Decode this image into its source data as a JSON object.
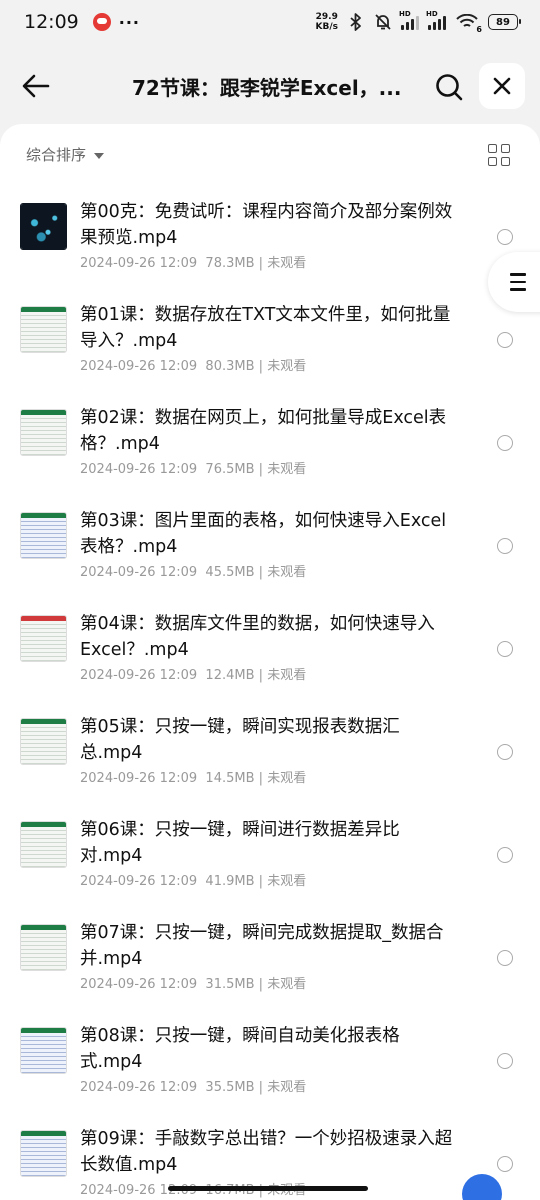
{
  "status_bar": {
    "time": "12:09",
    "net_speed_value": "29.9",
    "net_speed_unit": "KB/s",
    "signal_tag_1": "HD",
    "signal_tag_2": "HD",
    "wifi_tag": "6",
    "battery": "89"
  },
  "header": {
    "title": "72节课：跟李锐学Excel，..."
  },
  "sort": {
    "label": "综合排序"
  },
  "files": [
    {
      "name": "第00克：免费试听：课程内容简介及部分案例效果预览.mp4",
      "date": "2024-09-26 12:09",
      "size": "78.3MB",
      "status": "未观看",
      "thumb": "dark"
    },
    {
      "name": "第01课：数据存放在TXT文本文件里，如何批量导入？.mp4",
      "date": "2024-09-26 12:09",
      "size": "80.3MB",
      "status": "未观看",
      "thumb": "green"
    },
    {
      "name": "第02课：数据在网页上，如何批量导成Excel表格？.mp4",
      "date": "2024-09-26 12:09",
      "size": "76.5MB",
      "status": "未观看",
      "thumb": "green"
    },
    {
      "name": "第03课：图片里面的表格，如何快速导入Excel表格？.mp4",
      "date": "2024-09-26 12:09",
      "size": "45.5MB",
      "status": "未观看",
      "thumb": "blue"
    },
    {
      "name": "第04课：数据库文件里的数据，如何快速导入Excel？.mp4",
      "date": "2024-09-26 12:09",
      "size": "12.4MB",
      "status": "未观看",
      "thumb": "red"
    },
    {
      "name": "第05课：只按一键，瞬间实现报表数据汇总.mp4",
      "date": "2024-09-26 12:09",
      "size": "14.5MB",
      "status": "未观看",
      "thumb": "green"
    },
    {
      "name": "第06课：只按一键，瞬间进行数据差异比对.mp4",
      "date": "2024-09-26 12:09",
      "size": "41.9MB",
      "status": "未观看",
      "thumb": "green"
    },
    {
      "name": "第07课：只按一键，瞬间完成数据提取_数据合并.mp4",
      "date": "2024-09-26 12:09",
      "size": "31.5MB",
      "status": "未观看",
      "thumb": "green"
    },
    {
      "name": "第08课：只按一键，瞬间自动美化报表格式.mp4",
      "date": "2024-09-26 12:09",
      "size": "35.5MB",
      "status": "未观看",
      "thumb": "blue"
    },
    {
      "name": "第09课：手敲数字总出错？一个妙招极速录入超长数值.mp4",
      "date": "2024-09-26 12:09",
      "size": "16.7MB",
      "status": "未观看",
      "thumb": "blue"
    }
  ],
  "meta_separator": "|",
  "icons": {
    "back": "arrow-left-icon",
    "search": "search-icon",
    "close": "close-icon",
    "grid": "grid-view-icon",
    "menu": "menu-icon"
  },
  "colors": {
    "background": "#f2f2f2",
    "sheet": "#ffffff",
    "meta_text": "#999999",
    "fab": "#2f6fe4"
  }
}
